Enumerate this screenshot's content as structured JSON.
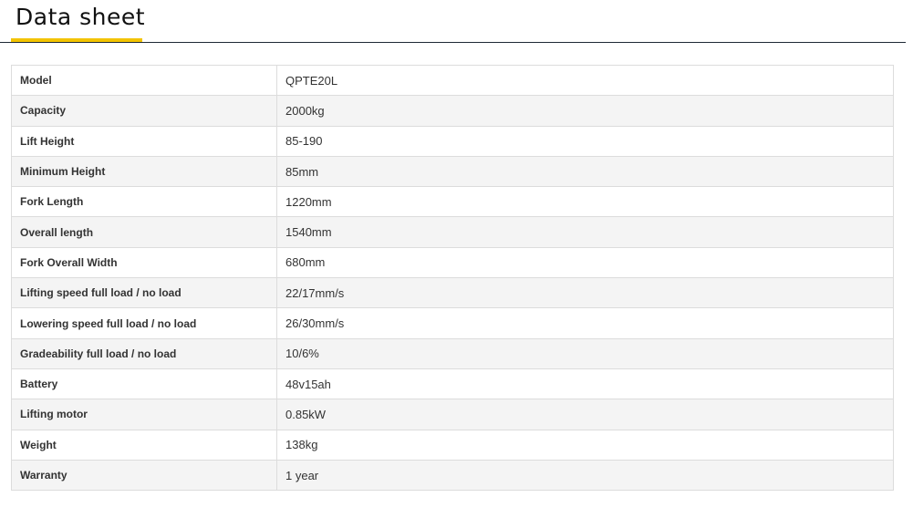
{
  "header": {
    "title": "Data sheet",
    "accent_color": "#f2c300",
    "rule_color": "#1e2a36"
  },
  "rows": [
    {
      "label": "Model",
      "value": "QPTE20L"
    },
    {
      "label": "Capacity",
      "value": "2000kg"
    },
    {
      "label": "Lift Height",
      "value": "85-190"
    },
    {
      "label": "Minimum Height",
      "value": "85mm"
    },
    {
      "label": "Fork Length",
      "value": "1220mm"
    },
    {
      "label": "Overall length",
      "value": "1540mm"
    },
    {
      "label": "Fork Overall Width",
      "value": "680mm"
    },
    {
      "label": "Lifting speed  full load / no load",
      "value": "22/17mm/s"
    },
    {
      "label": "Lowering speed  full load / no load",
      "value": "26/30mm/s"
    },
    {
      "label": "Gradeability full load / no load",
      "value": "10/6%"
    },
    {
      "label": "Battery",
      "value": "48v15ah"
    },
    {
      "label": "Lifting motor",
      "value": "0.85kW"
    },
    {
      "label": "Weight",
      "value": "138kg"
    },
    {
      "label": "Warranty",
      "value": "1 year"
    }
  ]
}
